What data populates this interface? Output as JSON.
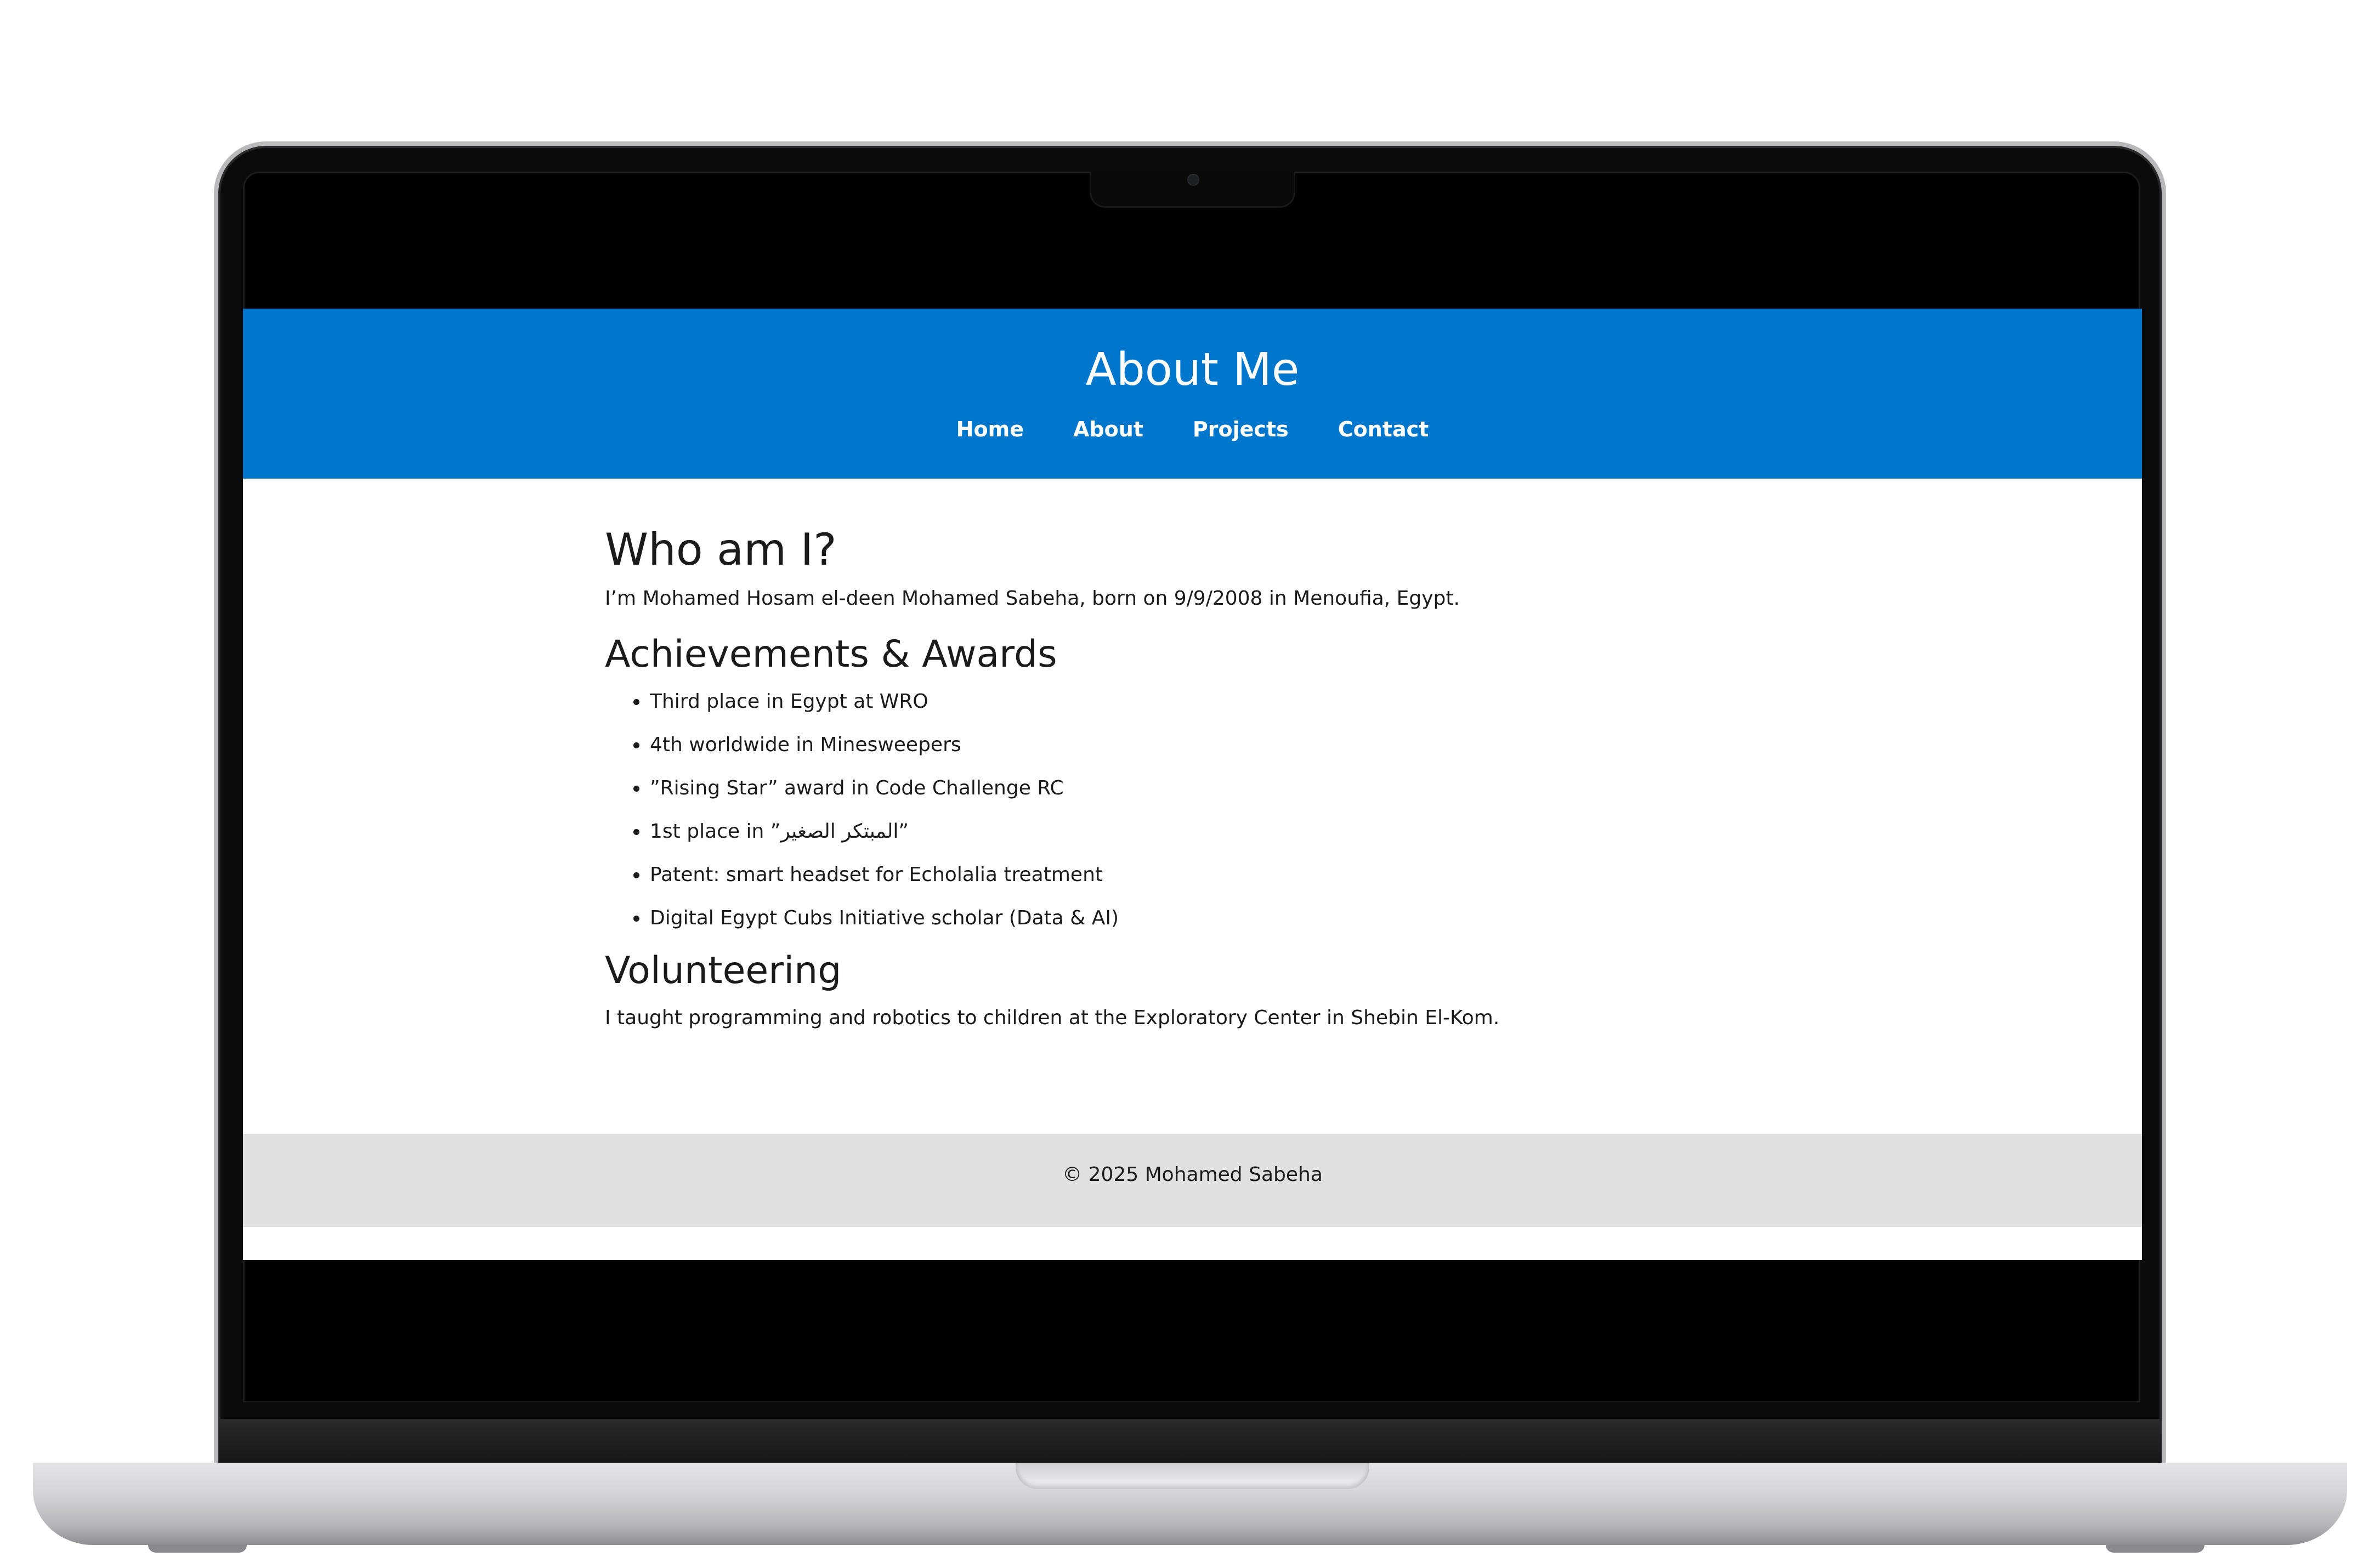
{
  "header": {
    "title": "About Me",
    "nav": [
      "Home",
      "About",
      "Projects",
      "Contact"
    ]
  },
  "main": {
    "who_heading": "Who am I?",
    "who_text": "I’m Mohamed Hosam el-deen Mohamed Sabeha, born on 9/9/2008 in Menoufia, Egypt.",
    "achievements_heading": "Achievements & Awards",
    "achievements": [
      "Third place in Egypt at WRO",
      "4th worldwide in Minesweepers",
      "”Rising Star” award in Code Challenge RC",
      "1st place in ”المبتكر الصغير”",
      "Patent: smart headset for Echolalia treatment",
      "Digital Egypt Cubs Initiative scholar (Data & AI)"
    ],
    "volunteering_heading": "Volunteering",
    "volunteering_text": "I taught programming and robotics to children at the Exploratory Center in Shebin El-Kom."
  },
  "footer": {
    "text": "© 2025 Mohamed Sabeha"
  },
  "colors": {
    "header_bg": "#0077cc",
    "footer_bg": "#e0e0e0"
  }
}
